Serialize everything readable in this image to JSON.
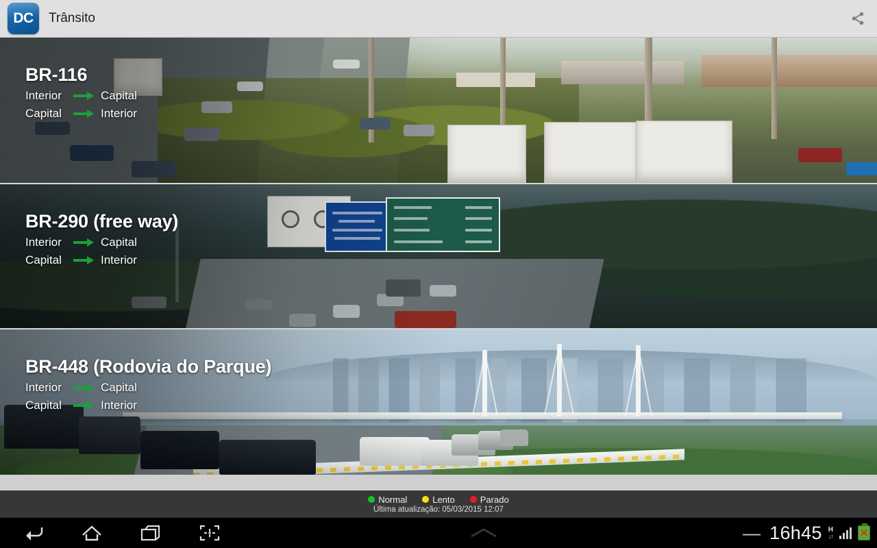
{
  "header": {
    "logo_text": "DC",
    "title": "Trânsito",
    "share_icon": "share-icon"
  },
  "roads": [
    {
      "name": "BR-116",
      "directions": [
        {
          "from": "Interior",
          "to": "Capital",
          "status": "normal",
          "color": "#1aa03c"
        },
        {
          "from": "Capital",
          "to": "Interior",
          "status": "normal",
          "color": "#1aa03c"
        }
      ]
    },
    {
      "name": "BR-290 (free way)",
      "directions": [
        {
          "from": "Interior",
          "to": "Capital",
          "status": "normal",
          "color": "#1aa03c"
        },
        {
          "from": "Capital",
          "to": "Interior",
          "status": "normal",
          "color": "#1aa03c"
        }
      ]
    },
    {
      "name": "BR-448 (Rodovia do Parque)",
      "directions": [
        {
          "from": "Interior",
          "to": "Capital",
          "status": "normal",
          "color": "#1aa03c"
        },
        {
          "from": "Capital",
          "to": "Interior",
          "status": "normal",
          "color": "#1aa03c"
        }
      ]
    }
  ],
  "legend": {
    "items": [
      {
        "label": "Normal",
        "color": "#17c131"
      },
      {
        "label": "Lento",
        "color": "#f2e414"
      },
      {
        "label": "Parado",
        "color": "#e81d1d"
      }
    ],
    "update_text": "Última atualização: 05/03/2015 12:07"
  },
  "navbar": {
    "back_icon": "back-arrow-icon",
    "home_icon": "home-icon",
    "recents_icon": "recent-apps-icon",
    "screenshot_icon": "screen-capture-icon",
    "handle_icon": "multi-window-chevron-icon",
    "minus_label": "—",
    "clock": "16h45",
    "data_label": "H",
    "data_arrows": "↓↑",
    "signal_icon": "signal-bars-icon",
    "battery_icon": "battery-error-icon"
  }
}
